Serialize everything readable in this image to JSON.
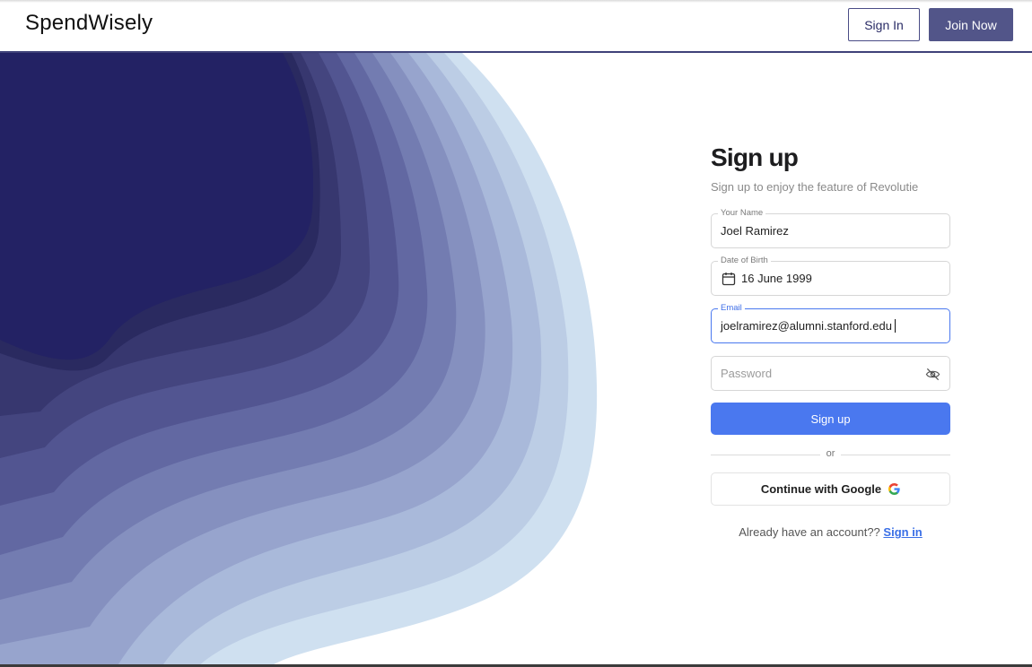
{
  "header": {
    "brand": "SpendWisely",
    "sign_in_label": "Sign In",
    "join_label": "Join Now"
  },
  "form": {
    "title": "Sign up",
    "subtitle": "Sign up to enjoy the feature of Revolutie",
    "name": {
      "label": "Your Name",
      "value": "Joel Ramirez"
    },
    "dob": {
      "label": "Date of Birth",
      "value": "16 June 1999",
      "icon": "calendar-icon"
    },
    "email": {
      "label": "Email",
      "value": "joelramirez@alumni.stanford.edu"
    },
    "password": {
      "placeholder": "Password",
      "icon": "eye-off-icon"
    },
    "submit_label": "Sign up",
    "divider_text": "or",
    "google_label": "Continue with Google",
    "google_icon": "google-icon",
    "already_text": "Already have an account??",
    "signin_link": "Sign in"
  },
  "colors": {
    "primary": "#4a78ef",
    "navy": "#232264",
    "header_button": "#525589",
    "wave_palette": [
      "#cfe0f0",
      "#bccde5",
      "#a9b9da",
      "#97a4cd",
      "#8590bf",
      "#737cb1",
      "#6268a2",
      "#525591",
      "#44457f",
      "#37376f",
      "#2a2a60",
      "#232264"
    ]
  }
}
